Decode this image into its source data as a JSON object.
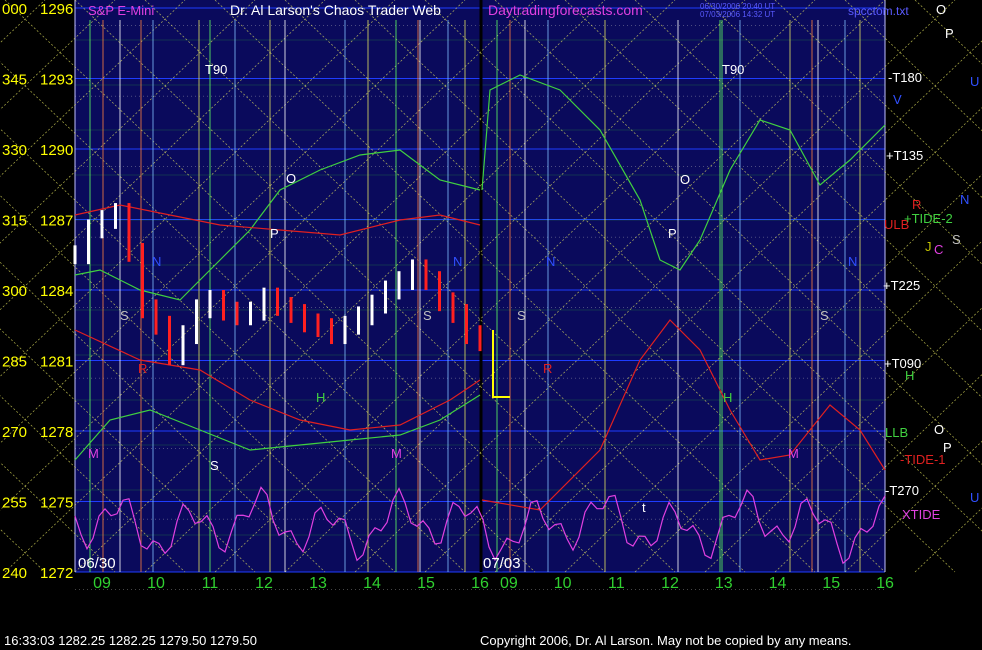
{
  "header": {
    "product": "S&P E-Mini",
    "title": "Dr. Al Larson's Chaos Trader Web",
    "site": "Daytradingforecasts.com",
    "stamp_line1": "06/30/2006 20:40 UT",
    "stamp_line2": "07/03/2006 14:32 UT",
    "file": "spcctom.txt"
  },
  "status": {
    "left": "16:33:03   1282.25  1282.25  1279.50  1279.50",
    "right": "Copyright 2006, Dr. Al Larson. May not be copied by any means."
  },
  "colors": {
    "background": "#0a0a5c",
    "grid": "#c8c8c8",
    "yellow_lines": "#e8e860",
    "green_lines": "#30c030",
    "price_up": "#ffffff",
    "price_down": "#ff2020",
    "forecast_green": "#40d040",
    "forecast_red": "#e02020",
    "xtide": "#e040e0"
  },
  "chart_data": {
    "type": "line",
    "title": "S&P E-Mini",
    "y_left_price": [
      1296,
      1293,
      1290,
      1287,
      1284,
      1281,
      1278,
      1275,
      1272
    ],
    "y_left_angle": [
      "000",
      "345",
      "330",
      "315",
      "300",
      "285",
      "270",
      "255",
      "240"
    ],
    "ylim": [
      1272,
      1296
    ],
    "x_ticks": [
      "09",
      "10",
      "11",
      "12",
      "13",
      "14",
      "15",
      "16",
      "09",
      "10",
      "11",
      "12",
      "13",
      "14",
      "15",
      "16"
    ],
    "dates": [
      "06/30",
      "07/03"
    ],
    "sessions": [
      {
        "date": "06/30",
        "price_series_approx": [
          {
            "t": 8.5,
            "close": 1285.5
          },
          {
            "t": 8.75,
            "close": 1286.6
          },
          {
            "t": 9.0,
            "close": 1287.0
          },
          {
            "t": 9.25,
            "close": 1287.3
          },
          {
            "t": 9.5,
            "close": 1285.6
          },
          {
            "t": 9.75,
            "close": 1283.2
          },
          {
            "t": 10.0,
            "close": 1282.5
          },
          {
            "t": 10.25,
            "close": 1281.2
          },
          {
            "t": 10.5,
            "close": 1282.1
          },
          {
            "t": 10.75,
            "close": 1283.2
          },
          {
            "t": 11.0,
            "close": 1283.6
          },
          {
            "t": 11.25,
            "close": 1283.1
          },
          {
            "t": 11.5,
            "close": 1282.9
          },
          {
            "t": 11.75,
            "close": 1283.1
          },
          {
            "t": 12.0,
            "close": 1283.7
          },
          {
            "t": 12.25,
            "close": 1283.3
          },
          {
            "t": 12.5,
            "close": 1283.0
          },
          {
            "t": 12.75,
            "close": 1282.6
          },
          {
            "t": 13.0,
            "close": 1282.4
          },
          {
            "t": 13.25,
            "close": 1282.1
          },
          {
            "t": 13.5,
            "close": 1282.5
          },
          {
            "t": 13.75,
            "close": 1282.9
          },
          {
            "t": 14.0,
            "close": 1283.4
          },
          {
            "t": 14.25,
            "close": 1284.0
          },
          {
            "t": 14.5,
            "close": 1284.4
          },
          {
            "t": 14.75,
            "close": 1284.9
          },
          {
            "t": 15.0,
            "close": 1284.4
          },
          {
            "t": 15.25,
            "close": 1283.5
          },
          {
            "t": 15.5,
            "close": 1283.0
          },
          {
            "t": 15.75,
            "close": 1282.1
          },
          {
            "t": 16.0,
            "close": 1281.8
          }
        ]
      },
      {
        "date": "07/03",
        "price_series_approx": []
      }
    ],
    "right_labels": [
      "O",
      "P",
      "-T180",
      "U",
      "V",
      "+T135",
      "R",
      "N",
      "ULB",
      "+TIDE-2",
      "J",
      "C",
      "S",
      "+T225",
      "+T090",
      "H",
      "LLB",
      "O",
      "P",
      "-TIDE-1",
      "-T270",
      "U",
      "XTIDE"
    ],
    "chart_labels": [
      "T90",
      "T90",
      "O",
      "P",
      "N",
      "N",
      "N",
      "N",
      "S",
      "S",
      "S",
      "S",
      "H",
      "H",
      "M",
      "M",
      "M",
      "R",
      "R",
      "O",
      "P",
      "t",
      "S"
    ],
    "series": [
      {
        "name": "XTIDE",
        "color": "#e040e0"
      },
      {
        "name": "+TIDE-2",
        "color": "#40d040"
      },
      {
        "name": "-TIDE-1",
        "color": "#e02020"
      }
    ],
    "grid": true
  }
}
